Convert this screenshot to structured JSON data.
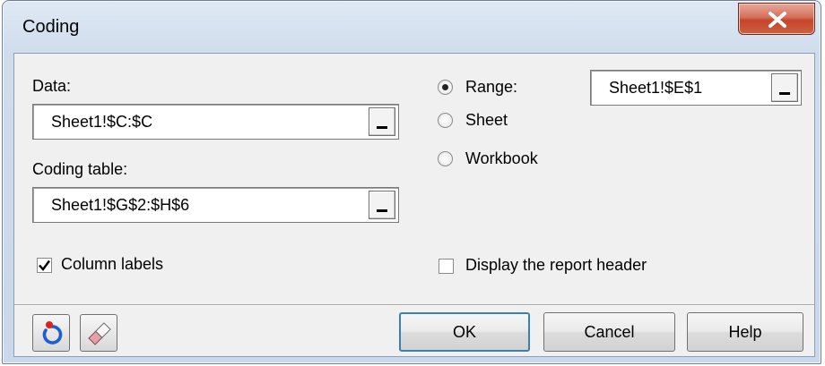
{
  "window": {
    "title": "Coding",
    "close_glyph": "X"
  },
  "data_field": {
    "label": "Data:",
    "value": "Sheet1!$C:$C"
  },
  "coding_table_field": {
    "label": "Coding table:",
    "value": "Sheet1!$G$2:$H$6"
  },
  "output": {
    "options": [
      {
        "label": "Range:",
        "selected": true
      },
      {
        "label": "Sheet",
        "selected": false
      },
      {
        "label": "Workbook",
        "selected": false
      }
    ],
    "range_value": "Sheet1!$E$1"
  },
  "checkboxes": {
    "column_labels": {
      "label": "Column labels",
      "checked": true
    },
    "report_header": {
      "label": "Display the report header",
      "checked": false
    }
  },
  "buttons": {
    "ok": "OK",
    "cancel": "Cancel",
    "help": "Help"
  },
  "icons": {
    "reset": "reset-icon",
    "eraser": "eraser-icon",
    "ref_picker": "ref-picker-icon"
  }
}
